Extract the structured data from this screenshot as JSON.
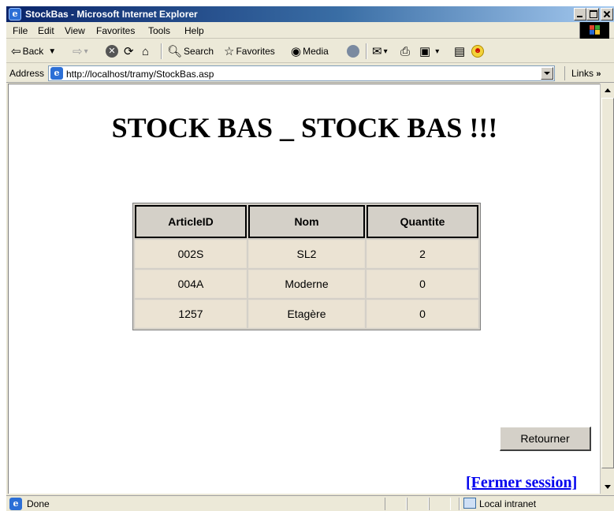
{
  "window": {
    "title": "StockBas - Microsoft Internet Explorer"
  },
  "menu": [
    "File",
    "Edit",
    "View",
    "Favorites",
    "Tools",
    "Help"
  ],
  "toolbar": {
    "back": "Back",
    "search": "Search",
    "favorites": "Favorites",
    "media": "Media"
  },
  "address": {
    "label": "Address",
    "url": "http://localhost/tramy/StockBas.asp",
    "links": "Links"
  },
  "page": {
    "heading": "STOCK BAS _ STOCK BAS !!!",
    "table": {
      "headers": [
        "ArticleID",
        "Nom",
        "Quantite"
      ],
      "rows": [
        [
          "002S",
          "SL2",
          "2"
        ],
        [
          "004A",
          "Moderne",
          "0"
        ],
        [
          "1257",
          "Etagère",
          "0"
        ]
      ]
    },
    "retourner_label": "Retourner",
    "fermer_session_label": "[Fermer session]"
  },
  "status": {
    "text": "Done",
    "zone": "Local intranet"
  },
  "colors": {
    "title_bar": "#0a246a",
    "link": "#0000ee",
    "cell_bg": "#ebe3d3",
    "header_bg": "#d4d0c8"
  }
}
